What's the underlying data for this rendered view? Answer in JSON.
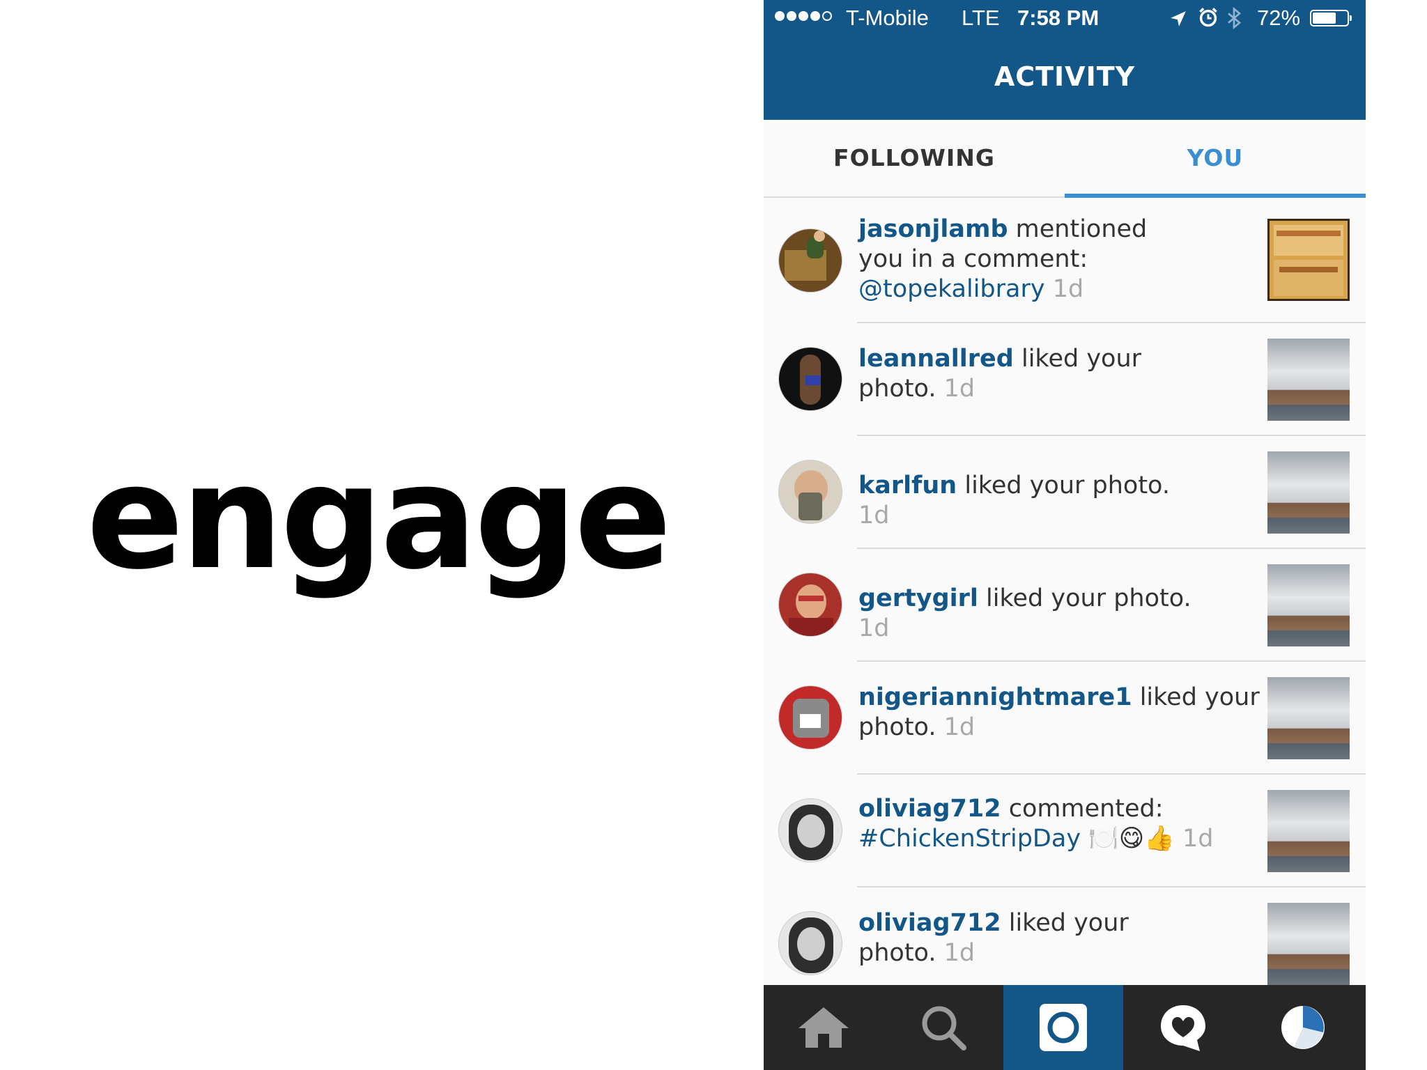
{
  "slide": {
    "word": "engage"
  },
  "status_bar": {
    "carrier": "T-Mobile",
    "network": "LTE",
    "time": "7:58 PM",
    "battery": "72%",
    "battery_level": 0.72,
    "signal_bars": 4,
    "icons": [
      "location-icon",
      "alarm-icon",
      "bluetooth-icon",
      "battery-icon"
    ]
  },
  "nav": {
    "title": "ACTIVITY"
  },
  "tabs": {
    "following": "FOLLOWING",
    "you": "YOU",
    "active": "you"
  },
  "colors": {
    "brand": "#135789",
    "accent": "#3b8fd0",
    "muted": "#a8a8a8",
    "tabbar": "#262626"
  },
  "feed": [
    {
      "user": "jasonjlamb",
      "action": " mentioned you in a comment: ",
      "mention": "@topekalibrary",
      "age": "1d"
    },
    {
      "user": "leannallred",
      "action": " liked your photo. ",
      "age": "1d"
    },
    {
      "user": "karlfun",
      "action": " liked your photo. ",
      "age": "1d"
    },
    {
      "user": "gertygirl",
      "action": " liked your photo. ",
      "age": "1d"
    },
    {
      "user": "nigeriannightmare1",
      "action": " liked your photo. ",
      "age": "1d"
    },
    {
      "user": "oliviag712",
      "action": " commented: ",
      "mention": "#ChickenStripDay",
      "emoji": "🍽️😋👍",
      "age": "1d"
    },
    {
      "user": "oliviag712",
      "action": " liked your photo. ",
      "age": "1d"
    }
  ],
  "tab_bar": {
    "items": [
      "home-icon",
      "search-icon",
      "camera-icon",
      "activity-icon",
      "profile-icon"
    ],
    "active": "camera-icon"
  }
}
